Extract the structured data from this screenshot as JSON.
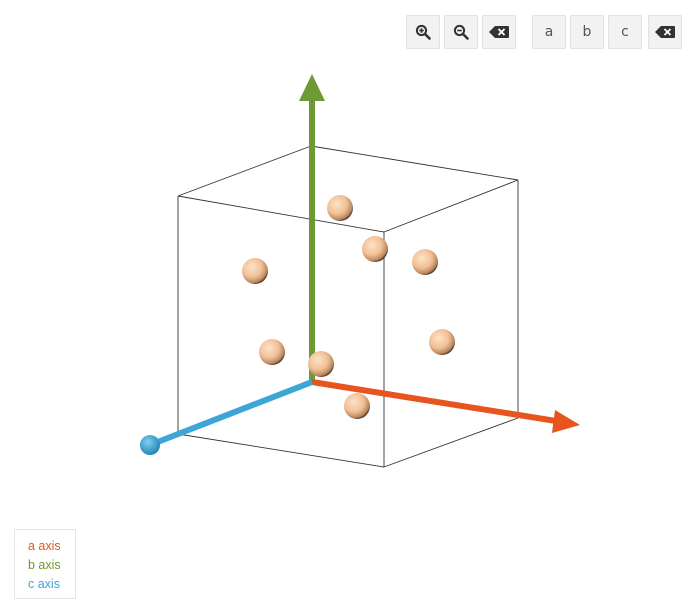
{
  "toolbar": {
    "zoom_in": {
      "icon": "zoom-in-icon"
    },
    "zoom_out": {
      "icon": "zoom-out-icon"
    },
    "reset": {
      "icon": "backspace-icon"
    },
    "view_a": {
      "label": "a"
    },
    "view_b": {
      "label": "b"
    },
    "view_c": {
      "label": "c"
    },
    "clear": {
      "icon": "backspace-icon"
    }
  },
  "legend": {
    "items": [
      {
        "label": "a axis",
        "color": "#e8541e"
      },
      {
        "label": "b axis",
        "color": "#6e9a33"
      },
      {
        "label": "c axis",
        "color": "#3ea6d6"
      }
    ]
  },
  "scene": {
    "axis_colors": {
      "a": "#e8541e",
      "b": "#6e9a33",
      "c": "#3ea6d6"
    },
    "atom_color": "#f4c49b",
    "atom_count": 9
  }
}
